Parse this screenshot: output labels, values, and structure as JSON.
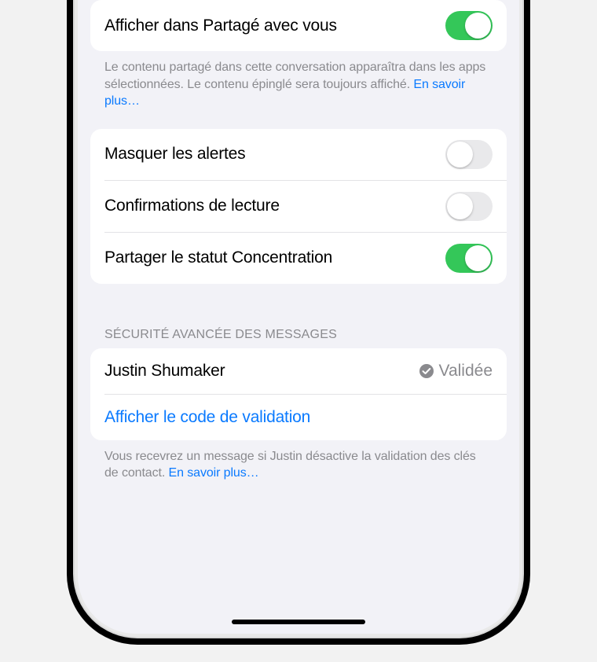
{
  "section1": {
    "show_in_shared_label": "Afficher dans Partagé avec vous",
    "footer": "Le contenu partagé dans cette conversation apparaîtra dans les apps sélectionnées. Le contenu épinglé sera toujours affiché. ",
    "footer_link": "En savoir plus…"
  },
  "section2": {
    "hide_alerts_label": "Masquer les alertes",
    "read_receipts_label": "Confirmations de lecture",
    "share_focus_label": "Partager le statut Concentration"
  },
  "section3": {
    "header": "SÉCURITÉ AVANCÉE DES MESSAGES",
    "contact_name": "Justin Shumaker",
    "status_text": "Validée",
    "show_code_label": "Afficher le code de validation",
    "footer": "Vous recevrez un message si Justin désactive la validation des clés de contact. ",
    "footer_link": "En savoir plus…"
  }
}
